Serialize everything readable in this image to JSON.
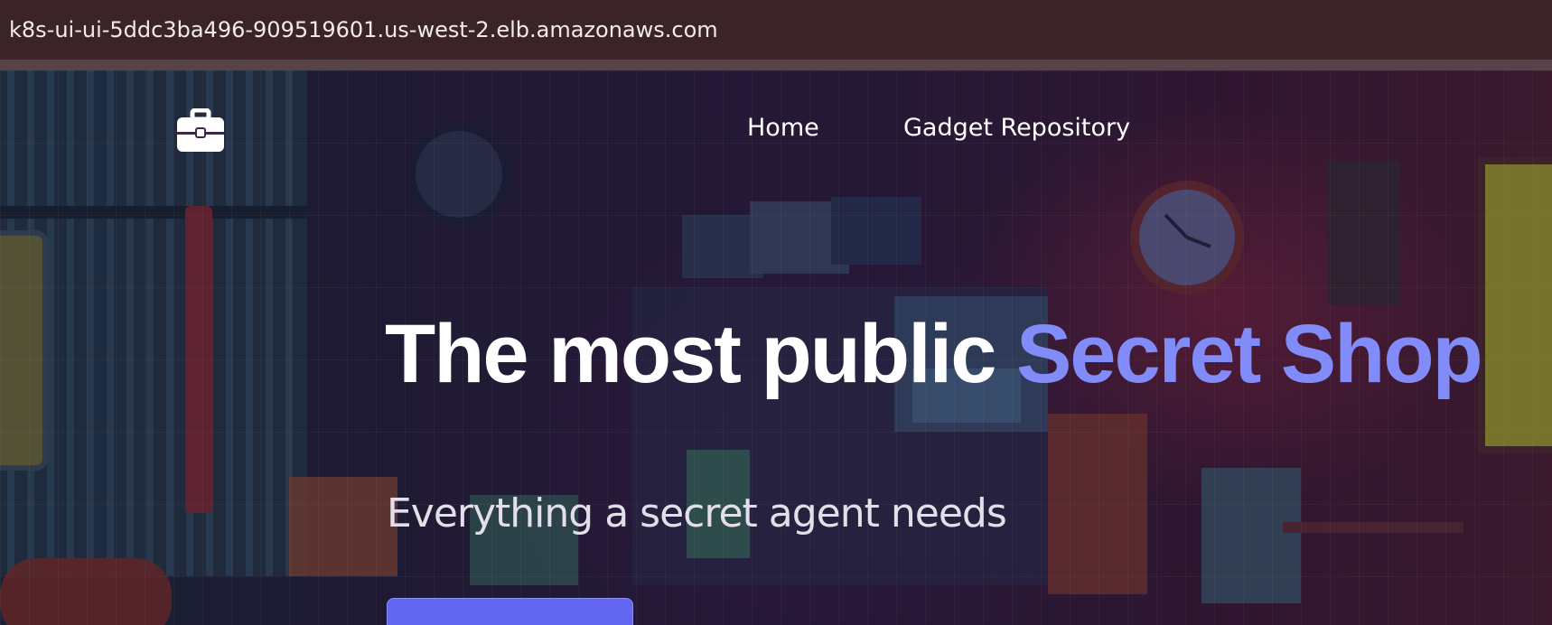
{
  "browser": {
    "url": "k8s-ui-ui-5ddc3ba496-909519601.us-west-2.elb.amazonaws.com"
  },
  "header": {
    "logo_icon": "briefcase-icon",
    "nav": [
      {
        "label": "Home"
      },
      {
        "label": "Gadget Repository"
      }
    ]
  },
  "hero": {
    "headline_plain": "The most public ",
    "headline_accent": "Secret Shop",
    "subheadline": "Everything a secret agent needs",
    "cta_label": ""
  },
  "colors": {
    "accent": "#818cf8",
    "button": "#6366f1",
    "address_bar": "#3a2428"
  }
}
